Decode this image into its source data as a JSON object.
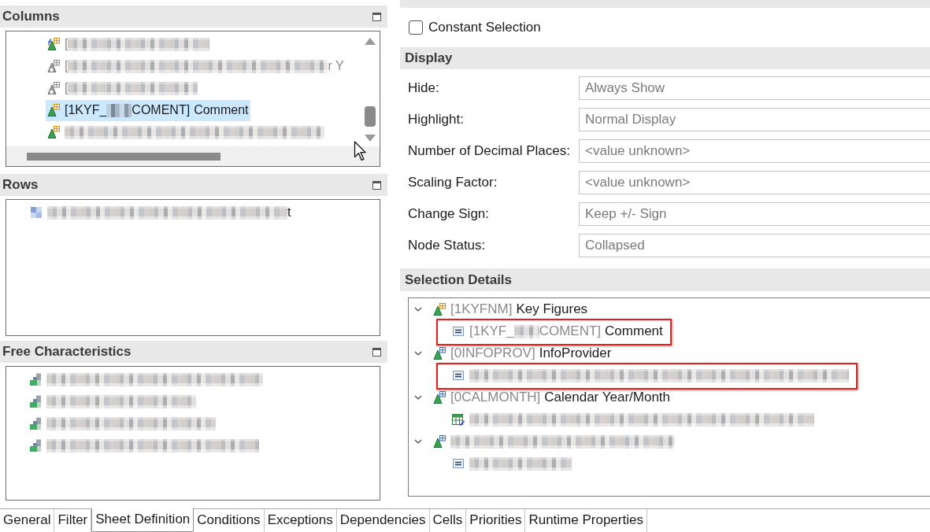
{
  "columns_panel": {
    "title": "Columns",
    "items": [
      {
        "kind": "formula",
        "prefix": "[",
        "blurred": true,
        "selected": false
      },
      {
        "kind": "inactive",
        "prefix": "[",
        "blurred": true,
        "suffix": "r Y",
        "selected": false
      },
      {
        "kind": "inactive",
        "prefix": "[",
        "blurred": true,
        "selected": false
      },
      {
        "kind": "keyfigure",
        "prefix": "[1KYF_",
        "blurred": true,
        "suffix": "COMENT]",
        "name": "Comment",
        "selected": true
      },
      {
        "kind": "keyfigure",
        "blurred": true,
        "selected": false
      }
    ]
  },
  "rows_panel": {
    "title": "Rows",
    "items": [
      {
        "kind": "structure",
        "blurred": true,
        "suffix": "t"
      }
    ]
  },
  "free_characteristics_panel": {
    "title": "Free Characteristics",
    "items": [
      {
        "kind": "charbar",
        "blurred": true
      },
      {
        "kind": "charbar",
        "blurred": true
      },
      {
        "kind": "charbar",
        "blurred": true
      },
      {
        "kind": "charbar",
        "blurred": true
      }
    ]
  },
  "constant_selection": {
    "label": "Constant Selection",
    "checked": false
  },
  "display": {
    "title": "Display",
    "fields": [
      {
        "label": "Hide:",
        "value": "Always Show",
        "disabled": true
      },
      {
        "label": "Highlight:",
        "value": "Normal Display",
        "disabled": true
      },
      {
        "label": "Number of Decimal Places:",
        "value": "<value unknown>",
        "disabled": true
      },
      {
        "label": "Scaling Factor:",
        "value": "<value unknown>",
        "disabled": true
      },
      {
        "label": "Change Sign:",
        "value": "Keep +/- Sign",
        "disabled": true
      },
      {
        "label": "Node Status:",
        "value": "Collapsed",
        "disabled": true
      }
    ]
  },
  "selection_details": {
    "title": "Selection Details",
    "tree": [
      {
        "kind": "keyfigure",
        "prefix": "[1KYFNM]",
        "name": "Key Figures",
        "expanded": true,
        "children": [
          {
            "kind": "member",
            "prefix": "[1KYF_",
            "blurred": true,
            "suffix": "COMENT]",
            "name": "Comment",
            "highlighted": true
          }
        ]
      },
      {
        "kind": "characteristic",
        "prefix": "[0INFOPROV]",
        "name": "InfoProvider",
        "expanded": true,
        "children": [
          {
            "kind": "member",
            "blurred": true,
            "highlighted": true
          }
        ]
      },
      {
        "kind": "characteristic",
        "prefix": "[0CALMONTH]",
        "name": "Calendar Year/Month",
        "expanded": true,
        "children": [
          {
            "kind": "variable",
            "blurred": true,
            "highlighted": false
          }
        ]
      },
      {
        "kind": "characteristic",
        "blurred": true,
        "expanded": true,
        "children": [
          {
            "kind": "member",
            "blurred": true,
            "highlighted": false
          }
        ]
      }
    ]
  },
  "tabs": [
    {
      "label": "General",
      "selected": false
    },
    {
      "label": "Filter",
      "selected": false
    },
    {
      "label": "Sheet Definition",
      "selected": true
    },
    {
      "label": "Conditions",
      "selected": false
    },
    {
      "label": "Exceptions",
      "selected": false
    },
    {
      "label": "Dependencies",
      "selected": false
    },
    {
      "label": "Cells",
      "selected": false
    },
    {
      "label": "Priorities",
      "selected": false
    },
    {
      "label": "Runtime Properties",
      "selected": false
    }
  ]
}
